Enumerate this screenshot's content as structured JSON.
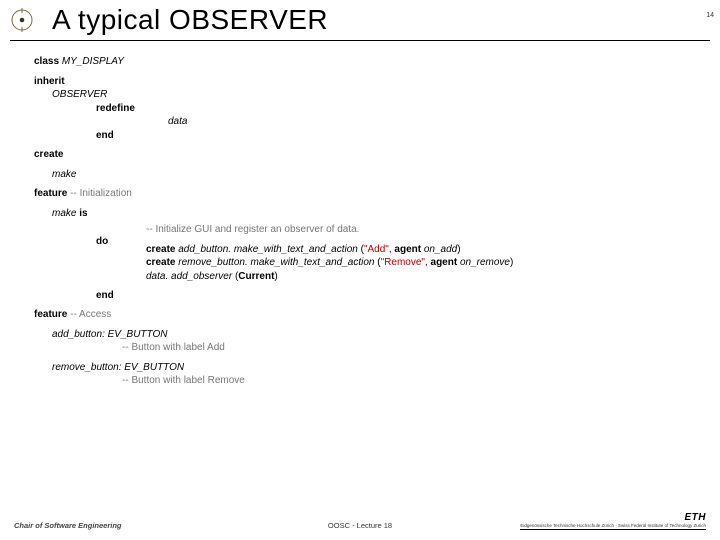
{
  "slide": {
    "title": "A typical OBSERVER",
    "page_number": "14"
  },
  "code": {
    "kw_class": "class",
    "class_name": "MY_DISPLAY",
    "kw_inherit": "inherit",
    "parent_class": "OBSERVER",
    "kw_redefine": "redefine",
    "redefined_feature": "data",
    "kw_end1": "end",
    "kw_create": "create",
    "creator": "make",
    "kw_feature1": "feature",
    "comment_init": "-- Initialization",
    "make_decl": "make",
    "kw_is": "is",
    "kw_do": "do",
    "comment_make": "-- Initialize GUI and register an observer of data.",
    "kw_create_inline1": "create",
    "add_expr_a": "add_button. make_with_text_and_action",
    "add_label": "\"Add\"",
    "agent_kw1": "agent",
    "on_add": "on_add",
    "kw_create_inline2": "create",
    "rem_expr_a": "remove_button. make_with_text_and_action",
    "rem_label": "\"Remove\"",
    "agent_kw2": "agent",
    "on_remove": "on_remove",
    "data_line_a": "data. add_observer",
    "current_kw": "Current",
    "kw_end2": "end",
    "kw_feature2": "feature",
    "comment_access": "-- Access",
    "add_btn_decl_name": "add_button",
    "add_btn_decl_type": ": EV_BUTTON",
    "add_btn_comment": "-- Button with label Add",
    "rem_btn_decl_name": "remove_button",
    "rem_btn_decl_type": ": EV_BUTTON",
    "rem_btn_comment": "-- Button with label Remove"
  },
  "footer": {
    "left": "Chair of Software Engineering",
    "mid": "OOSC - Lecture 18",
    "eth_main": "ETH",
    "eth_sub": "Eidgenössische Technische Hochschule Zürich · Swiss Federal Institute of Technology Zurich"
  }
}
